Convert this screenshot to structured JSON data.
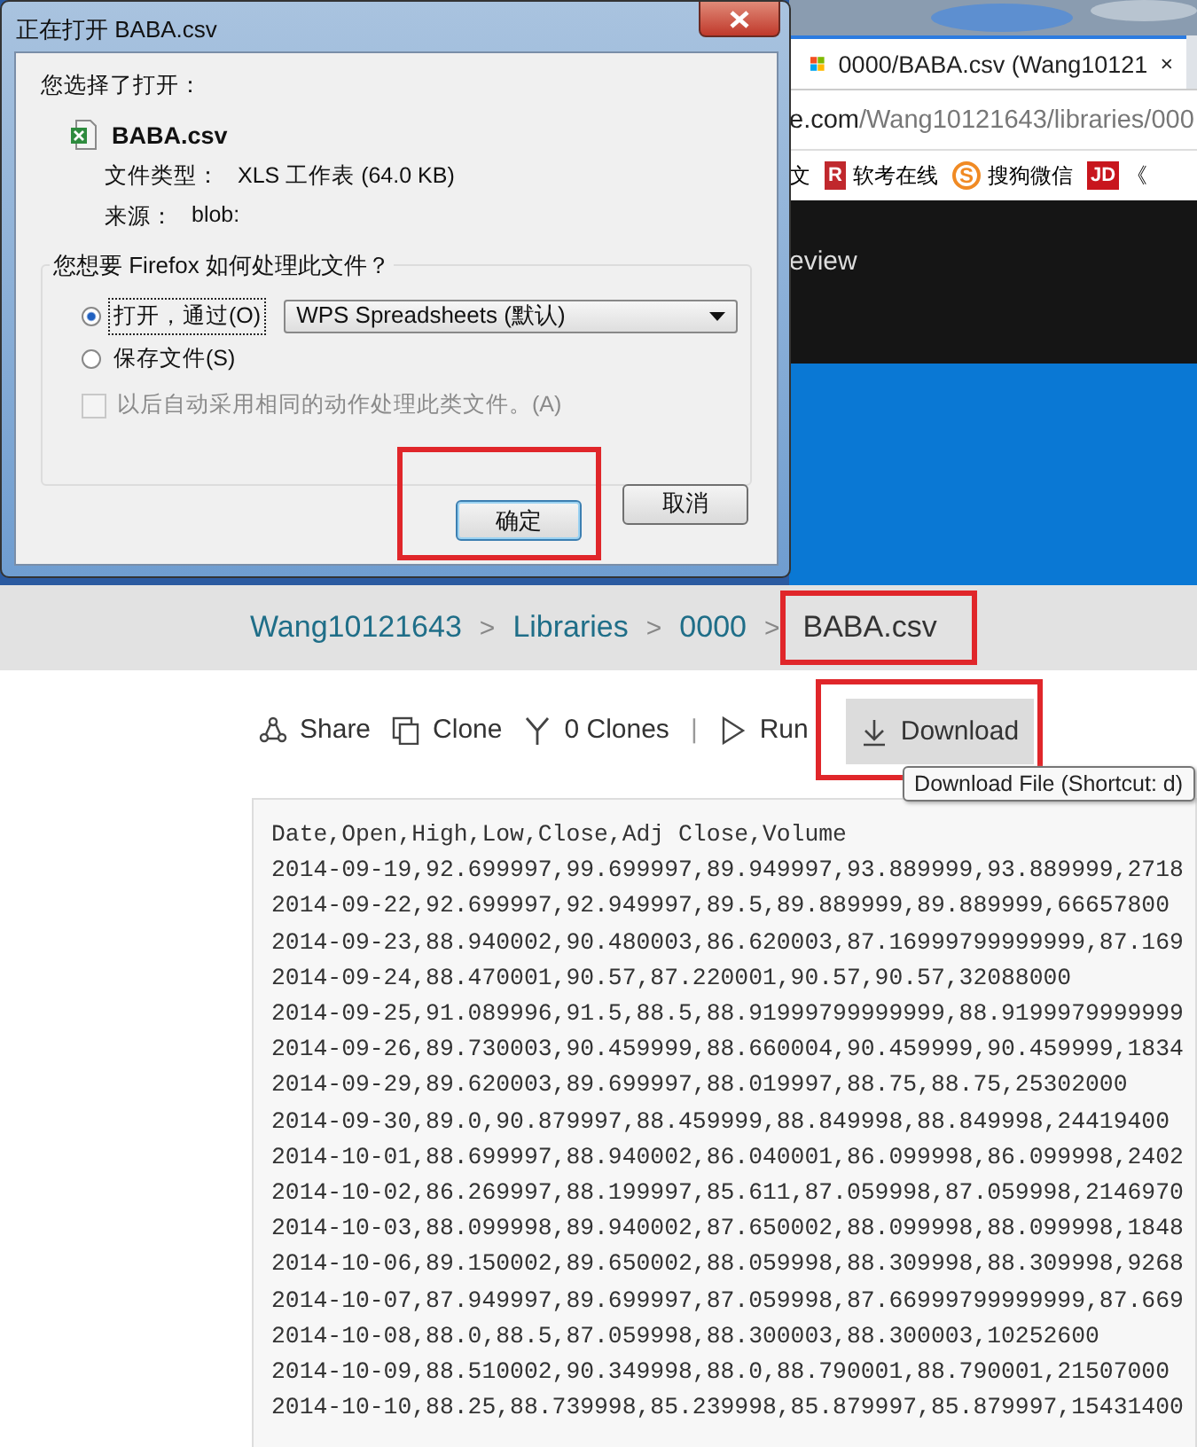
{
  "browser": {
    "tab": {
      "title": "0000/BABA.csv (Wang10121",
      "selected": true
    },
    "url_host": "e.com",
    "url_path": "/Wang10121643/libraries/000",
    "bookmarks": [
      {
        "kind": "text",
        "label": "文"
      },
      {
        "kind": "badge",
        "badge": "R",
        "color": "#c0282d",
        "label": "软考在线"
      },
      {
        "kind": "circle",
        "badge": "S",
        "color": "#f08a24",
        "label": "搜狗微信"
      },
      {
        "kind": "badge",
        "badge": "JD",
        "color": "#c8161d",
        "label": "《"
      }
    ],
    "nav_items": [
      "eview"
    ]
  },
  "breadcrumb": [
    {
      "label": "Wang10121643",
      "current": false,
      "highlighted": false
    },
    {
      "separator": ">",
      "label": "Libraries",
      "current": false,
      "highlighted": false
    },
    {
      "separator": ">",
      "label": "0000",
      "current": false,
      "highlighted": false
    },
    {
      "separator": ">",
      "label": "BABA.csv",
      "current": true,
      "highlighted": true
    }
  ],
  "toolbar": [
    {
      "kind": "share",
      "label": "Share",
      "hovered": false,
      "highlighted": false
    },
    {
      "kind": "clone",
      "label": "Clone",
      "hovered": false,
      "highlighted": false
    },
    {
      "kind": "fork",
      "label": "0 Clones",
      "hovered": false,
      "highlighted": false
    },
    {
      "kind": "separator",
      "label": "|"
    },
    {
      "kind": "run",
      "label": "Run",
      "hovered": false,
      "highlighted": false
    },
    {
      "kind": "download",
      "label": "Download",
      "hovered": true,
      "highlighted": true
    }
  ],
  "tooltip": "Download File (Shortcut: d)",
  "code_lines": [
    "Date,Open,High,Low,Close,Adj Close,Volume",
    "2014-09-19,92.699997,99.699997,89.949997,93.889999,93.889999,2718",
    "2014-09-22,92.699997,92.949997,89.5,89.889999,89.889999,66657800",
    "2014-09-23,88.940002,90.480003,86.620003,87.16999799999999,87.169",
    "2014-09-24,88.470001,90.57,87.220001,90.57,90.57,32088000",
    "2014-09-25,91.089996,91.5,88.5,88.91999799999999,88.9199979999999",
    "2014-09-26,89.730003,90.459999,88.660004,90.459999,90.459999,1834",
    "2014-09-29,89.620003,89.699997,88.019997,88.75,88.75,25302000",
    "2014-09-30,89.0,90.879997,88.459999,88.849998,88.849998,24419400",
    "2014-10-01,88.699997,88.940002,86.040001,86.099998,86.099998,2402",
    "2014-10-02,86.269997,88.199997,85.611,87.059998,87.059998,2146970",
    "2014-10-03,88.099998,89.940002,87.650002,88.099998,88.099998,1848",
    "2014-10-06,89.150002,89.650002,88.059998,88.309998,88.309998,9268",
    "2014-10-07,87.949997,89.699997,87.059998,87.66999799999999,87.669",
    "2014-10-08,88.0,88.5,87.059998,88.300003,88.300003,10252600",
    "2014-10-09,88.510002,90.349998,88.0,88.790001,88.790001,21507000",
    "2014-10-10,88.25,88.739998,85.239998,85.879997,85.879997,15431400"
  ],
  "dialog": {
    "title": "正在打开 BABA.csv",
    "intro": "您选择了打开：",
    "file_name": "BABA.csv",
    "file_type_label": "文件类型：",
    "file_type": "XLS 工作表 (64.0 KB)",
    "source_label": "来源：",
    "source": "blob:",
    "question": "您想要 Firefox 如何处理此文件？",
    "options": [
      {
        "label": "打开，通过(O)",
        "selected": true,
        "focused": true
      },
      {
        "label": "保存文件(S)",
        "selected": false,
        "focused": false
      }
    ],
    "application": "WPS Spreadsheets (默认)",
    "remember": {
      "label": "以后自动采用相同的动作处理此类文件。(A)",
      "checked": false,
      "disabled": true
    },
    "buttons": [
      {
        "label": "确定",
        "default": true,
        "highlighted": true
      },
      {
        "label": "取消",
        "default": false,
        "highlighted": false
      }
    ]
  }
}
